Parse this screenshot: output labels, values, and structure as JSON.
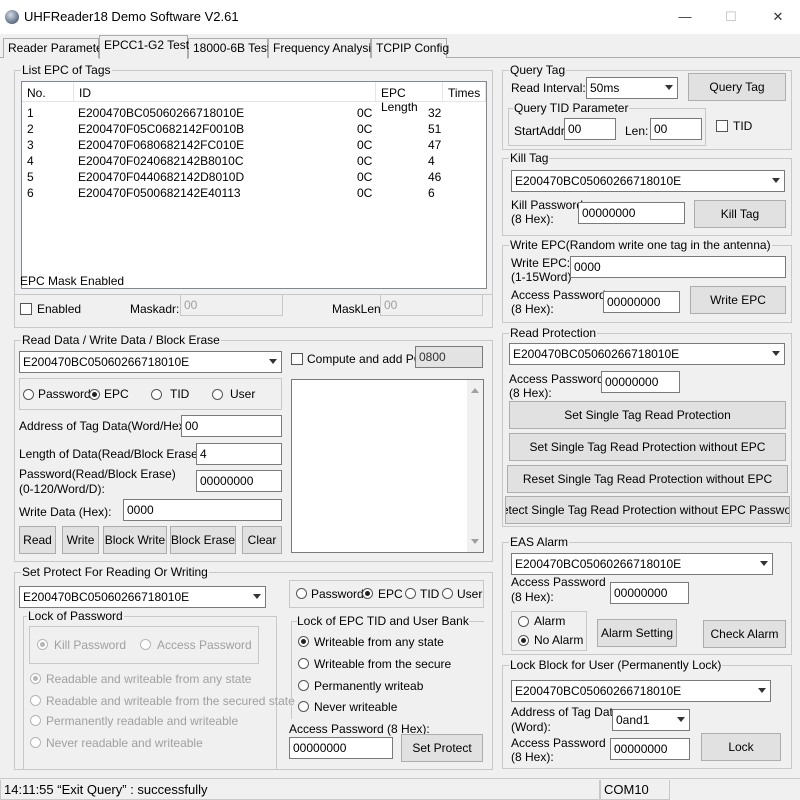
{
  "window": {
    "title": "UHFReader18 Demo Software V2.61",
    "minimize": "—",
    "maximize": "☐",
    "close": "✕"
  },
  "tabs": [
    "Reader Parameter",
    "EPCC1-G2 Test",
    "18000-6B Test",
    "Frequency Analysis",
    "TCPIP Config"
  ],
  "list_epc": {
    "title": "List EPC of Tags",
    "headers": [
      "No.",
      "ID",
      "EPC Length",
      "Times"
    ],
    "rows": [
      [
        "1",
        "E200470BC05060266718010E",
        "0C",
        "32"
      ],
      [
        "2",
        "E200470F05C0682142F0010B",
        "0C",
        "51"
      ],
      [
        "3",
        "E200470F0680682142FC010E",
        "0C",
        "47"
      ],
      [
        "4",
        "E200470F0240682142B8010C",
        "0C",
        "4"
      ],
      [
        "5",
        "E200470F0440682142D8010D",
        "0C",
        "46"
      ],
      [
        "6",
        "E200470F0500682142E40113",
        "0C",
        "6"
      ]
    ]
  },
  "epc_mask": {
    "title": "EPC Mask Enabled",
    "enabled_label": "Enabled",
    "maskadr_label": "Maskadr:",
    "maskadr_value": "00",
    "masklen_label": "MaskLen:",
    "masklen_value": "00"
  },
  "rw": {
    "title": "Read Data / Write Data / Block Erase",
    "tag_select": "E200470BC05060266718010E",
    "compute_pc_label": "Compute and add PC:",
    "pc_value": "0800",
    "mem_password": "Password",
    "mem_epc": "EPC",
    "mem_tid": "TID",
    "mem_user": "User",
    "addr_label": "Address of Tag Data(Word/Hex):",
    "addr_value": "00",
    "len_label": "Length of Data(Read/Block Erase:",
    "len_value": "4",
    "pwd_label1": "Password(Read/Block Erase)",
    "pwd_label2": "(0-120/Word/D):",
    "pwd_value": "00000000",
    "write_label": "Write Data (Hex):",
    "write_value": "0000",
    "btn_read": "Read",
    "btn_write": "Write",
    "btn_block_write": "Block Write",
    "btn_block_erase": "Block Erase",
    "btn_clear": "Clear"
  },
  "protect": {
    "title": "Set Protect For Reading Or Writing",
    "tag_select": "E200470BC05060266718010E",
    "lock_pwd_title": "Lock of Password",
    "kill_pwd": "Kill Password",
    "access_pwd": "Access Password",
    "opt1": "Readable and  writeable from any state",
    "opt2": "Readable and writeable from the secured state",
    "opt3": "Permanently readable and writeable",
    "opt4": "Never readable and writeable",
    "mem_password": "Password",
    "mem_epc": "EPC",
    "mem_tid": "TID",
    "mem_user": "User",
    "lock_bank_title": "Lock of EPC TID and User Bank",
    "bank1": "Writeable from any state",
    "bank2": "Writeable from the secure",
    "bank3": "Permanently writeab",
    "bank4": "Never writeable",
    "access_label": "Access Password (8 Hex):",
    "access_value": "00000000",
    "btn_set_protect": "Set Protect"
  },
  "query": {
    "title": "Query Tag",
    "interval_label": "Read Interval:",
    "interval_value": "50ms",
    "btn_query": "Query Tag",
    "tid_param_title": "Query TID Parameter",
    "startaddr_label": "StartAddr:",
    "startaddr_value": "00",
    "len_label": "Len:",
    "len_value": "00",
    "tid_label": "TID"
  },
  "kill": {
    "title": "Kill Tag",
    "tag_select": "E200470BC05060266718010E",
    "pwd_label1": "Kill Password",
    "pwd_label2": "(8 Hex):",
    "pwd_value": "00000000",
    "btn": "Kill Tag"
  },
  "write_epc": {
    "title": "Write EPC(Random write one tag in the antenna)",
    "epc_label1": "Write EPC:",
    "epc_label2": "(1-15Word)",
    "epc_value": "0000",
    "pwd_label1": "Access Password",
    "pwd_label2": "(8 Hex):",
    "pwd_value": "00000000",
    "btn": "Write EPC"
  },
  "read_protect": {
    "title": "Read Protection",
    "tag_select": "E200470BC05060266718010E",
    "pwd_label1": "Access Password",
    "pwd_label2": "(8 Hex):",
    "pwd_value": "00000000",
    "btn1": "Set Single Tag Read Protection",
    "btn2": "Set Single Tag Read Protection without EPC",
    "btn3": "Reset Single Tag Read Protection without EPC",
    "btn4": "Detect Single Tag Read Protection without EPC Password"
  },
  "eas": {
    "title": "EAS Alarm",
    "tag_select": "E200470BC05060266718010E",
    "pwd_label1": "Access Password",
    "pwd_label2": "(8 Hex):",
    "pwd_value": "00000000",
    "alarm": "Alarm",
    "no_alarm": "No Alarm",
    "btn_setting": "Alarm Setting",
    "btn_check": "Check Alarm"
  },
  "lock_block": {
    "title": "Lock Block for User (Permanently Lock)",
    "tag_select": "E200470BC05060266718010E",
    "addr_label1": "Address of Tag Data",
    "addr_label2": "(Word):",
    "addr_value": "0and1",
    "pwd_label1": "Access Password",
    "pwd_label2": "(8 Hex):",
    "pwd_value": "00000000",
    "btn": "Lock"
  },
  "status": {
    "message": "14:11:55 “Exit Query” : successfully",
    "port": "COM10"
  }
}
